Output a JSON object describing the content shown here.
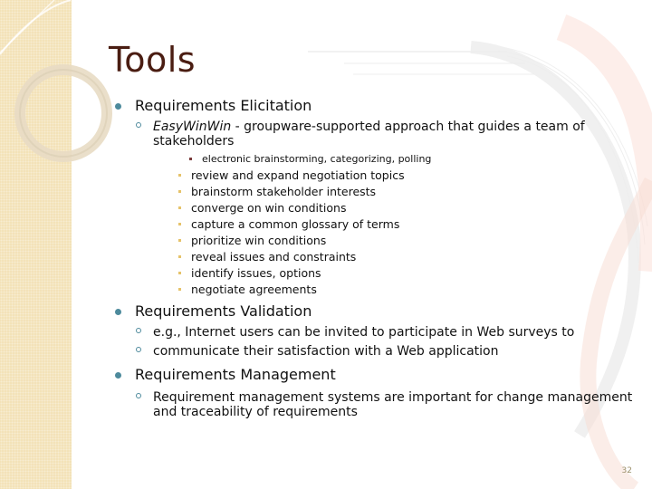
{
  "slide": {
    "title": "Tools",
    "page_number": "32",
    "colors": {
      "title": "#4a1d12",
      "bullet_level1": "#4d8a9c",
      "bullet_level3": "#7a3a3a",
      "bullet_level4": "#e6c36a",
      "left_panel": "#f3e2b8"
    },
    "sections": [
      {
        "heading": "Requirements Elicitation",
        "sub": {
          "emphasis": "EasyWinWin",
          "text": " - groupware-supported approach that guides a team of stakeholders",
          "detail": "electronic brainstorming, categorizing, polling",
          "steps": [
            "review and expand negotiation topics",
            "brainstorm stakeholder interests",
            "converge on win conditions",
            "capture a common glossary of terms",
            "prioritize win conditions",
            "reveal issues and constraints",
            "identify issues, options",
            "negotiate agreements"
          ]
        }
      },
      {
        "heading": "Requirements Validation",
        "items": [
          "e.g., Internet users can be invited to participate in Web surveys to",
          "communicate their satisfaction with a Web application"
        ]
      },
      {
        "heading": "Requirements Management",
        "items": [
          "Requirement management systems are important for change management and traceability of requirements"
        ]
      }
    ]
  }
}
